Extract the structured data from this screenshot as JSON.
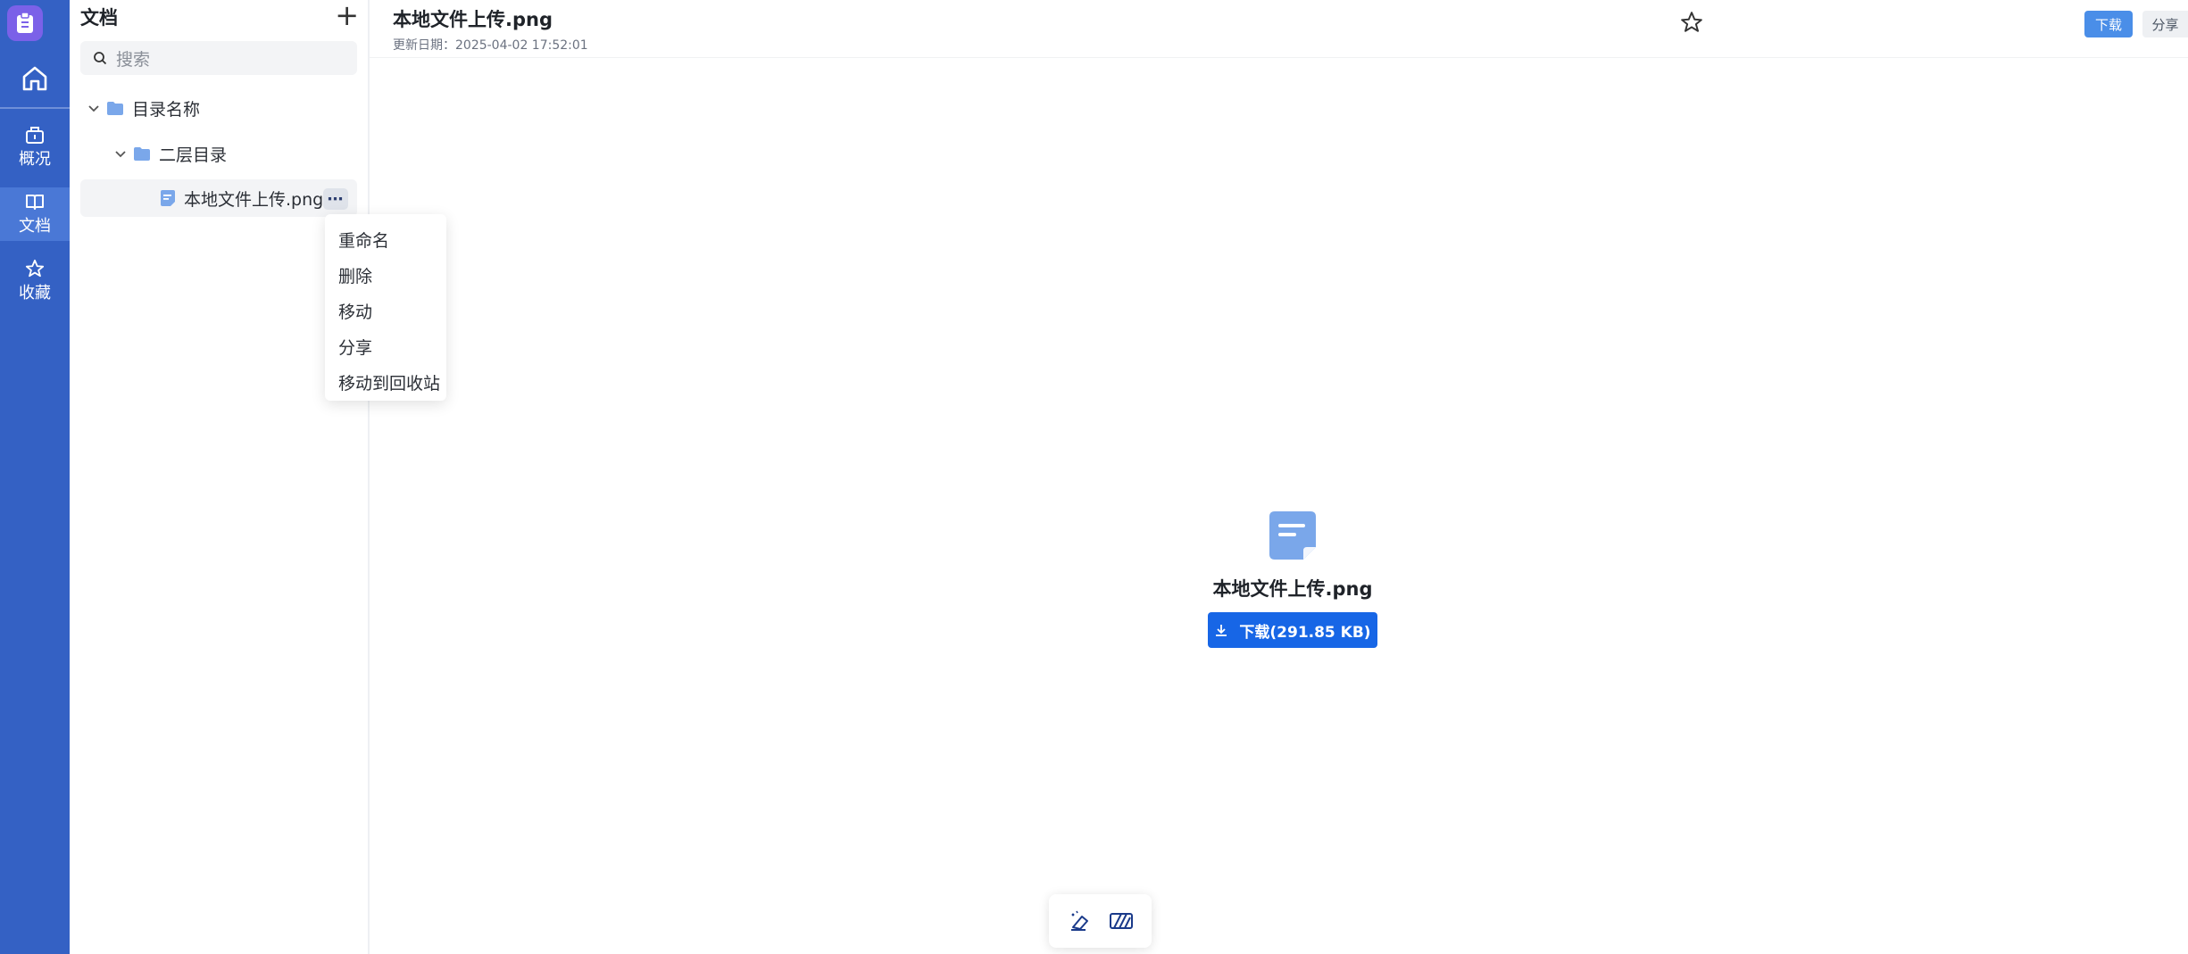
{
  "rail": {
    "items": [
      {
        "label": "概况",
        "icon": "briefcase-icon"
      },
      {
        "label": "文档",
        "icon": "book-icon",
        "active": true
      },
      {
        "label": "收藏",
        "icon": "star-icon"
      }
    ],
    "home_icon": "home-icon",
    "logo_icon": "clipboard-icon"
  },
  "tree": {
    "title": "文档",
    "add_icon": "plus-icon",
    "search_placeholder": "搜索",
    "nodes": [
      {
        "label": "目录名称",
        "type": "folder",
        "expanded": true
      },
      {
        "label": "二层目录",
        "type": "folder",
        "expanded": true
      },
      {
        "label": "本地文件上传.png",
        "type": "file",
        "selected": true
      }
    ],
    "more_label": "⋯"
  },
  "context_menu": {
    "items": [
      "重命名",
      "删除",
      "移动",
      "分享",
      "移动到回收站"
    ]
  },
  "header": {
    "title": "本地文件上传.png",
    "updated": "更新日期：2025-04-02 17:52:01",
    "download_label": "下载",
    "share_label": "分享"
  },
  "preview": {
    "file_name": "本地文件上传.png",
    "download_label": "下载(291.85 KB)"
  },
  "colors": {
    "rail": "#3461c4",
    "accent": "#1766e6",
    "folder": "#7aa7ea"
  }
}
